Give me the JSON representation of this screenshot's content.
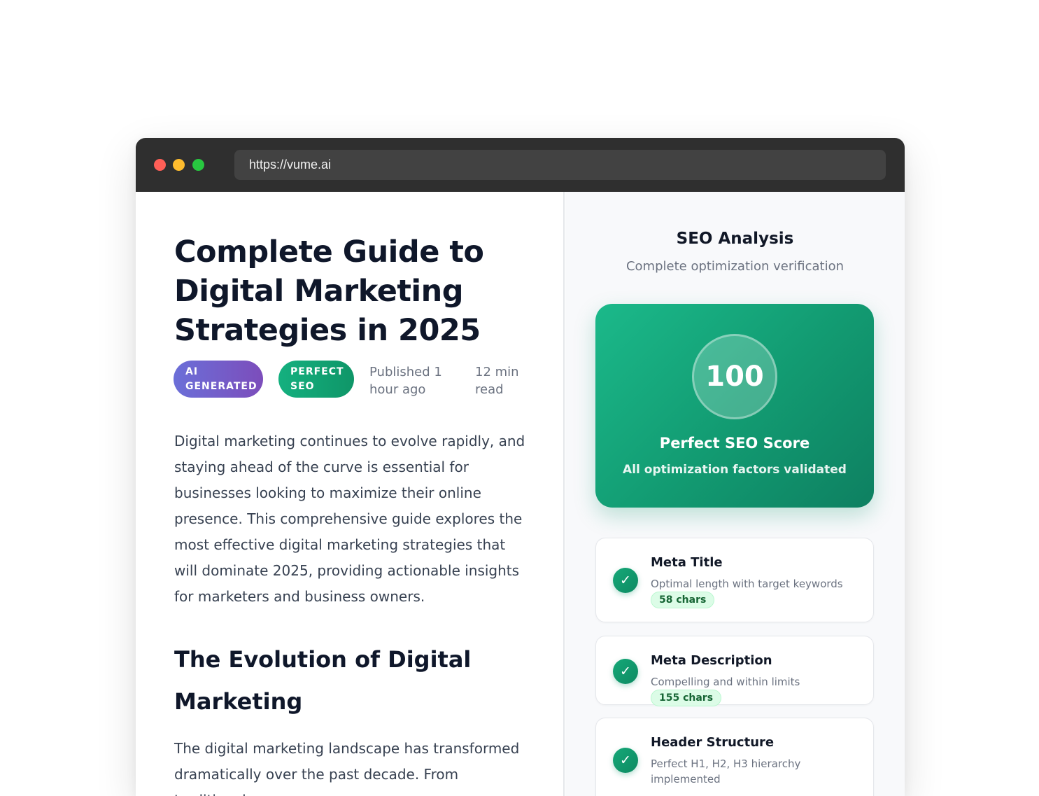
{
  "browser": {
    "url": "https://vume.ai"
  },
  "article": {
    "title": "Complete Guide to Digital Marketing Strategies in 2025",
    "badges": [
      "AI GENERATED",
      "PERFECT SEO"
    ],
    "published": "Published 1 hour ago",
    "read_time": "12 min read",
    "intro": "Digital marketing continues to evolve rapidly, and staying ahead of the curve is essential for businesses looking to maximize their online presence. This comprehensive guide explores the most effective digital marketing strategies that will dominate 2025, providing actionable insights for marketers and business owners.",
    "section_heading": "The Evolution of Digital Marketing",
    "section_text": "The digital marketing landscape has transformed dramatically over the past decade. From traditional"
  },
  "sidebar": {
    "title": "SEO Analysis",
    "subtitle": "Complete optimization verification",
    "score": {
      "value": "100",
      "label": "Perfect SEO Score",
      "sub": "All optimization factors validated"
    },
    "checks": [
      {
        "title": "Meta Title",
        "desc": "Optimal length with target keywords",
        "pill": "58 chars"
      },
      {
        "title": "Meta Description",
        "desc": "Compelling and within limits",
        "pill": "155 chars"
      },
      {
        "title": "Header Structure",
        "desc": "Perfect H1, H2, H3 hierarchy implemented",
        "pill": ""
      }
    ],
    "check_mark": "✓"
  },
  "colors": {
    "accent_green": "#129a71",
    "ai_badge": "#6b6fd8",
    "titlebar": "#2f2f2f"
  }
}
